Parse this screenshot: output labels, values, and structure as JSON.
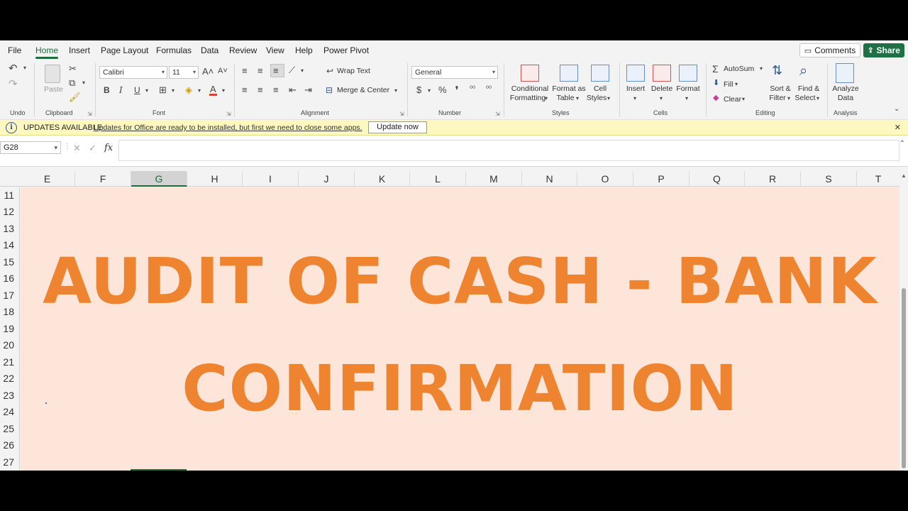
{
  "tabs": [
    "File",
    "Home",
    "Insert",
    "Page Layout",
    "Formulas",
    "Data",
    "Review",
    "View",
    "Help",
    "Power Pivot"
  ],
  "active_tab": "Home",
  "top_buttons": {
    "comments": "Comments",
    "share": "Share"
  },
  "ribbon": {
    "undo_group": "Undo",
    "clipboard": {
      "label": "Clipboard",
      "paste": "Paste"
    },
    "font": {
      "label": "Font",
      "family": "Calibri",
      "size": "11"
    },
    "alignment": {
      "label": "Alignment",
      "wrap_text": "Wrap Text",
      "merge_center": "Merge & Center"
    },
    "number": {
      "label": "Number",
      "format": "General"
    },
    "styles": {
      "label": "Styles",
      "conditional_1": "Conditional",
      "conditional_2": "Formatting",
      "format_as_1": "Format as",
      "format_as_2": "Table",
      "cell_styles_1": "Cell",
      "cell_styles_2": "Styles"
    },
    "cells": {
      "label": "Cells",
      "insert": "Insert",
      "delete": "Delete",
      "format": "Format"
    },
    "editing": {
      "label": "Editing",
      "autosum": "AutoSum",
      "fill": "Fill",
      "clear": "Clear",
      "sort_1": "Sort &",
      "sort_2": "Filter",
      "find_1": "Find &",
      "find_2": "Select"
    },
    "analysis": {
      "label": "Analysis",
      "analyze_1": "Analyze",
      "analyze_2": "Data"
    }
  },
  "updates_bar": {
    "title": "UPDATES AVAILABLE",
    "message": "Updates for Office are ready to be installed, but first we need to close some apps.",
    "button": "Update now"
  },
  "formula_bar": {
    "name_box": "G28",
    "fx": "fx"
  },
  "columns": [
    "E",
    "F",
    "G",
    "H",
    "I",
    "J",
    "K",
    "L",
    "M",
    "N",
    "O",
    "P",
    "Q",
    "R",
    "S",
    "T"
  ],
  "selected_column": "G",
  "rows": [
    "11",
    "12",
    "13",
    "14",
    "15",
    "16",
    "17",
    "18",
    "19",
    "20",
    "21",
    "22",
    "23",
    "24",
    "25",
    "26",
    "27"
  ],
  "sheet_text": {
    "line1": "AUDIT OF CASH - BANK",
    "line2": "CONFIRMATION"
  },
  "colors": {
    "text_orange": "#ee8430",
    "sheet_fill": "#fde5da",
    "accent_green": "#1e6b3c",
    "updates_bg": "#fdf7c0"
  }
}
